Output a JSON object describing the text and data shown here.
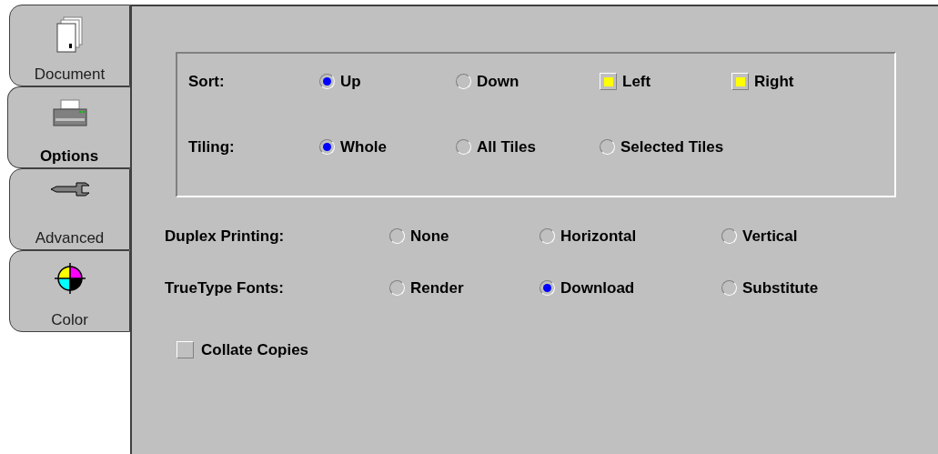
{
  "tabs": [
    {
      "label": "Document",
      "kind": "document",
      "selected": false
    },
    {
      "label": "Options",
      "kind": "printer",
      "selected": true
    },
    {
      "label": "Advanced",
      "kind": "wrench",
      "selected": false
    },
    {
      "label": "Color",
      "kind": "color",
      "selected": false
    }
  ],
  "group": {
    "rows": [
      {
        "label": "Sort:",
        "options": [
          {
            "kind": "radio",
            "label": "Up",
            "selected": true
          },
          {
            "kind": "radio",
            "label": "Down",
            "selected": false
          },
          {
            "kind": "checkbox",
            "label": "Left",
            "checked": true
          },
          {
            "kind": "checkbox",
            "label": "Right",
            "checked": true
          }
        ]
      },
      {
        "label": "Tiling:",
        "options": [
          {
            "kind": "radio",
            "label": "Whole",
            "selected": true
          },
          {
            "kind": "radio",
            "label": "All Tiles",
            "selected": false
          },
          {
            "kind": "radio",
            "label": "Selected Tiles",
            "selected": false
          }
        ]
      }
    ]
  },
  "rows": [
    {
      "label": "Duplex Printing:",
      "options": [
        {
          "kind": "radio",
          "label": "None",
          "selected": false
        },
        {
          "kind": "radio",
          "label": "Horizontal",
          "selected": false
        },
        {
          "kind": "radio",
          "label": "Vertical",
          "selected": false
        }
      ]
    },
    {
      "label": "TrueType Fonts:",
      "options": [
        {
          "kind": "radio",
          "label": "Render",
          "selected": false
        },
        {
          "kind": "radio",
          "label": "Download",
          "selected": true
        },
        {
          "kind": "radio",
          "label": "Substitute",
          "selected": false
        }
      ]
    }
  ],
  "collate": {
    "label": "Collate Copies",
    "checked": false
  }
}
